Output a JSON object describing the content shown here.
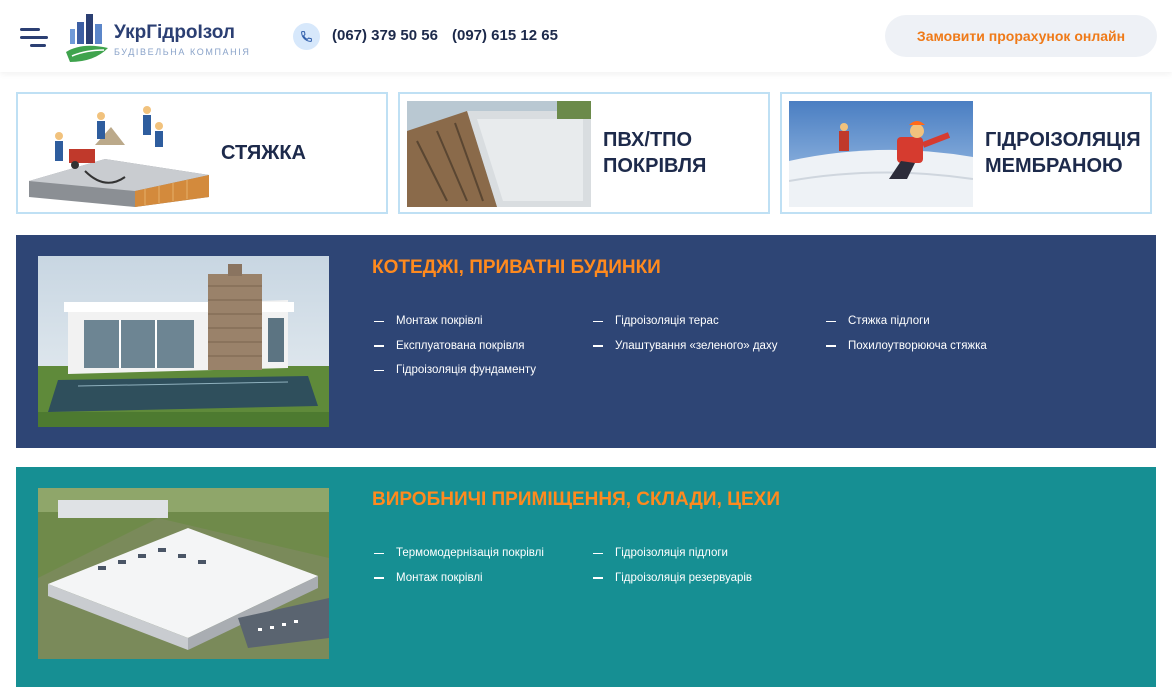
{
  "header": {
    "logo_title": "УкрГідроІзол",
    "logo_subtitle": "БУДІВЕЛЬНА КОМПАНІЯ",
    "phone_1": "(067) 379 50 56",
    "phone_2": "(097) 615 12 65",
    "cta_label": "Замовити прорахунок онлайн",
    "icons": [
      "menu-icon",
      "logo-icon",
      "phone-icon"
    ]
  },
  "services": [
    {
      "label": "СТЯЖКА",
      "image": "screed-workers-illustration"
    },
    {
      "label": "ПВХ/ТПО\nПОКРІВЛЯ",
      "image": "pvc-roof-photo"
    },
    {
      "label": "ГІДРОІЗОЛЯЦІЯ\nМЕМБРАНОЮ",
      "image": "membrane-worker-photo"
    }
  ],
  "categories": [
    {
      "title": "КОТЕДЖІ, ПРИВАТНІ БУДИНКИ",
      "color": "#2e4575",
      "image": "modern-house-photo",
      "columns": [
        [
          "Монтаж покрівлі",
          "Експлуатована покрівля",
          "Гідроізоляція фундаменту"
        ],
        [
          "Гідроізоляція терас",
          "Улаштування «зеленого» даху"
        ],
        [
          "Стяжка підлоги",
          "Похилоутворююча стяжка"
        ]
      ]
    },
    {
      "title": "ВИРОБНИЧІ ПРИМІЩЕННЯ, СКЛАДИ, ЦЕХИ",
      "color": "#168f93",
      "image": "industrial-building-aerial-photo",
      "columns": [
        [
          "Термомодернізація покрівлі",
          "Монтаж покрівлі"
        ],
        [
          "Гідроізоляція підлоги",
          "Гідроізоляція резервуарів"
        ]
      ]
    }
  ],
  "colors": {
    "accent": "#ef7a18",
    "navy": "#2b3f73",
    "teal": "#168f93",
    "card_border": "#bfe0f4"
  }
}
